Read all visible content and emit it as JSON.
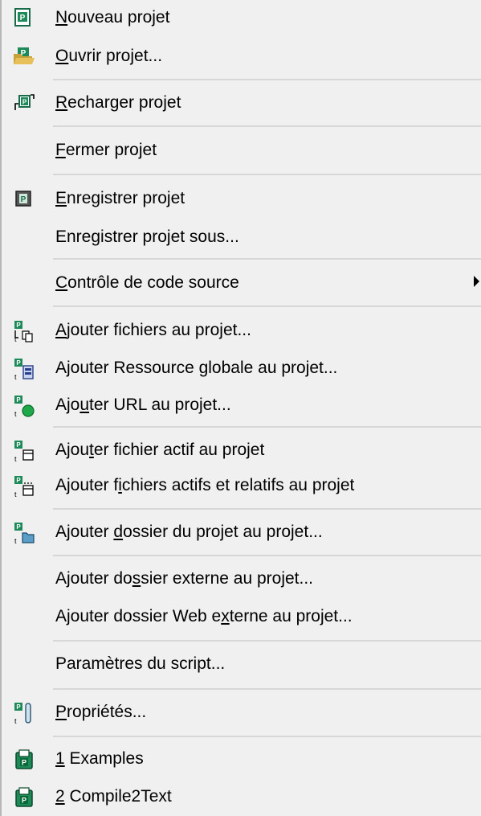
{
  "menu": {
    "items": [
      {
        "name": "nouveau-projet",
        "pre": "",
        "key": "N",
        "post": "ouveau projet",
        "icon": "new-project-icon"
      },
      {
        "name": "ouvrir-projet",
        "pre": "",
        "key": "O",
        "post": "uvrir projet...",
        "icon": "open-project-icon"
      },
      {
        "name": "recharger-projet",
        "pre": "",
        "key": "R",
        "post": "echarger projet",
        "icon": "reload-project-icon"
      },
      {
        "name": "fermer-projet",
        "pre": "",
        "key": "F",
        "post": "ermer projet",
        "icon": ""
      },
      {
        "name": "enregistrer-projet",
        "pre": "",
        "key": "E",
        "post": "nregistrer projet",
        "icon": "save-project-icon"
      },
      {
        "name": "enregistrer-projet-sous",
        "pre": "Enre",
        "key": "g",
        "post": "istrer projet sous...",
        "icon": ""
      },
      {
        "name": "controle-code-source",
        "pre": "",
        "key": "C",
        "post": "ontrôle de code source",
        "icon": "",
        "submenu": true
      },
      {
        "name": "ajouter-fichiers",
        "pre": "",
        "key": "A",
        "post": "jouter fichiers au projet...",
        "icon": "add-files-icon"
      },
      {
        "name": "ajouter-ressource-globale",
        "pre": "Ajouter Ressource globale au projet...",
        "key": "",
        "post": "",
        "icon": "add-global-resource-icon"
      },
      {
        "name": "ajouter-url",
        "pre": "Ajo",
        "key": "u",
        "post": "ter URL au projet...",
        "icon": "add-url-icon"
      },
      {
        "name": "ajouter-fichier-actif",
        "pre": "Ajou",
        "key": "t",
        "post": "er fichier actif au projet",
        "icon": "add-active-file-icon"
      },
      {
        "name": "ajouter-fichiers-actifs-relatifs",
        "pre": "Ajouter f",
        "key": "i",
        "post": "chiers actifs et relatifs au projet",
        "icon": "add-active-related-files-icon"
      },
      {
        "name": "ajouter-dossier-projet",
        "pre": "Ajouter ",
        "key": "d",
        "post": "ossier du projet au projet...",
        "icon": "add-project-folder-icon"
      },
      {
        "name": "ajouter-dossier-externe",
        "pre": "Ajouter do",
        "key": "s",
        "post": "sier externe au projet...",
        "icon": ""
      },
      {
        "name": "ajouter-dossier-web-externe",
        "pre": "Ajouter dossier Web e",
        "key": "x",
        "post": "terne au projet...",
        "icon": ""
      },
      {
        "name": "parametres-script",
        "pre": "Paramètres du script...",
        "key": "",
        "post": "",
        "icon": ""
      },
      {
        "name": "proprietes",
        "pre": "",
        "key": "P",
        "post": "ropriétés...",
        "icon": "properties-icon"
      },
      {
        "name": "recent-1-examples",
        "pre": "",
        "key": "1",
        "post": " Examples",
        "icon": "recent-project-icon"
      },
      {
        "name": "recent-2-compile2text",
        "pre": "",
        "key": "2",
        "post": " Compile2Text",
        "icon": "recent-project-icon"
      }
    ]
  },
  "colors": {
    "background": "#f0f0f0",
    "separator": "#d7d7d7",
    "project_green": "#1e8a5a",
    "folder_yellow": "#e0b84a"
  }
}
